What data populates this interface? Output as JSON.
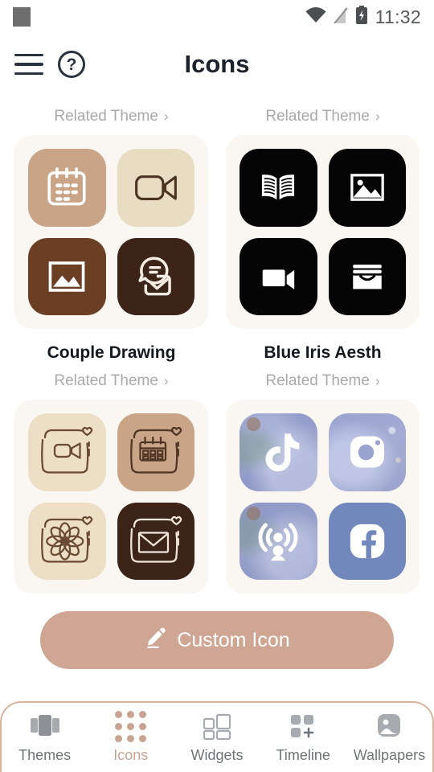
{
  "status_bar": {
    "time": "11:32",
    "icons": [
      "square-icon",
      "wifi-icon",
      "signal-off-icon",
      "battery-charging-icon"
    ]
  },
  "header": {
    "title": "Icons",
    "menu_icon": "hamburger-menu-icon",
    "help_icon": "help-circle-icon"
  },
  "main": {
    "related_theme_label": "Related Theme",
    "chevron": "›",
    "themes": [
      {
        "id": "theme-1",
        "title": "",
        "related_label": "Related Theme",
        "tiles": [
          {
            "icon": "calendar-icon",
            "bg": "#c9a486",
            "fg": "#ffffff"
          },
          {
            "icon": "video-camera-icon",
            "bg": "#e8dcc3",
            "fg": "#4a3322"
          },
          {
            "icon": "image-icon",
            "bg": "#6b3f24",
            "fg": "#ffffff"
          },
          {
            "icon": "chat-inbox-icon",
            "bg": "#3d2418",
            "fg": "#f5ede4"
          }
        ]
      },
      {
        "id": "theme-2",
        "title": "",
        "related_label": "Related Theme",
        "tiles": [
          {
            "icon": "open-book-icon",
            "bg": "#050505",
            "fg": "#ffffff"
          },
          {
            "icon": "image-icon",
            "bg": "#050505",
            "fg": "#ffffff"
          },
          {
            "icon": "video-camera-filled-icon",
            "bg": "#050505",
            "fg": "#ffffff"
          },
          {
            "icon": "inbox-archive-icon",
            "bg": "#050505",
            "fg": "#ffffff"
          }
        ]
      },
      {
        "id": "theme-3",
        "title": "Couple Drawing",
        "related_label": "Related Theme",
        "tiles": [
          {
            "icon": "sketch-video-camera-icon",
            "bg": "#ecdfc6",
            "fg": "#6b4a32"
          },
          {
            "icon": "sketch-calendar-icon",
            "bg": "#c9a486",
            "fg": "#4f3524"
          },
          {
            "icon": "sketch-flower-icon",
            "bg": "#ecdfc6",
            "fg": "#6b4a32"
          },
          {
            "icon": "sketch-envelope-icon",
            "bg": "#3d2418",
            "fg": "#f0e6da"
          }
        ]
      },
      {
        "id": "theme-4",
        "title": "Blue Iris Aesth",
        "related_label": "Related Theme",
        "tiles": [
          {
            "icon": "tiktok-icon",
            "bg": "#8d96c6",
            "fg": "#ffffff"
          },
          {
            "icon": "instagram-camera-icon",
            "bg": "#9aa2cf",
            "fg": "#ffffff"
          },
          {
            "icon": "podcast-broadcast-icon",
            "bg": "#8d96c6",
            "fg": "#ffffff"
          },
          {
            "icon": "facebook-icon",
            "bg": "#7288bd",
            "fg": "#ffffff"
          }
        ]
      }
    ]
  },
  "custom_button": {
    "label": "Custom Icon",
    "icon": "pencil-edit-icon",
    "color": "#cfa693"
  },
  "bottom_nav": {
    "active": "Icons",
    "accent": "#c9a392",
    "items": [
      {
        "label": "Themes",
        "icon": "themes-carousel-icon"
      },
      {
        "label": "Icons",
        "icon": "dot-grid-icon"
      },
      {
        "label": "Widgets",
        "icon": "widgets-squares-icon"
      },
      {
        "label": "Timeline",
        "icon": "timeline-plus-icon"
      },
      {
        "label": "Wallpapers",
        "icon": "wallpaper-image-icon"
      }
    ]
  }
}
